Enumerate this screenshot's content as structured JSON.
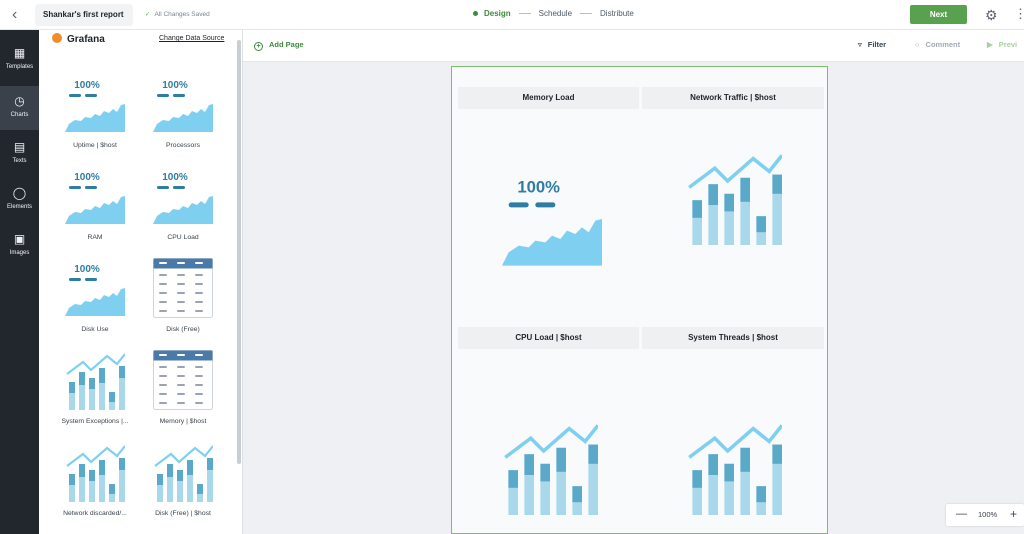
{
  "topbar": {
    "report_name": "Shankar's first report",
    "saved_status": "All Changes Saved",
    "steps": [
      "Design",
      "Schedule",
      "Distribute"
    ],
    "next_label": "Next"
  },
  "rail": {
    "items": [
      "Templates",
      "Charts",
      "Texts",
      "Elements",
      "Images"
    ],
    "active": "Charts"
  },
  "panel": {
    "source": "Grafana",
    "change_source": "Change Data Source",
    "tiles": [
      {
        "label": "Uptime | $host",
        "kind": "stat",
        "value": "100%"
      },
      {
        "label": "Processors",
        "kind": "stat",
        "value": "100%"
      },
      {
        "label": "RAM",
        "kind": "stat",
        "value": "100%"
      },
      {
        "label": "CPU Load",
        "kind": "stat",
        "value": "100%"
      },
      {
        "label": "Disk Use",
        "kind": "stat",
        "value": "100%"
      },
      {
        "label": "Disk (Free)",
        "kind": "table"
      },
      {
        "label": "System Exceptions |...",
        "kind": "bars"
      },
      {
        "label": "Memory | $host",
        "kind": "table"
      },
      {
        "label": "Network discarded/...",
        "kind": "bars"
      },
      {
        "label": "Disk (Free) | $host",
        "kind": "bars"
      }
    ]
  },
  "canvas": {
    "add_page": "Add Page",
    "filter": "Filter",
    "comment": "Comment",
    "preview": "Previ",
    "cards": [
      {
        "title": "Memory Load",
        "kind": "stat",
        "value": "100%"
      },
      {
        "title": "Network Traffic | $host",
        "kind": "bars"
      },
      {
        "title": "CPU Load | $host",
        "kind": "bars"
      },
      {
        "title": "System Threads | $host",
        "kind": "bars"
      }
    ]
  },
  "zoom": {
    "value": "100%"
  },
  "colors": {
    "accent_green": "#57a14f",
    "chart_light": "#7fd0f0",
    "chart_mid": "#5aa9c9",
    "chart_dark": "#2f7da3"
  }
}
